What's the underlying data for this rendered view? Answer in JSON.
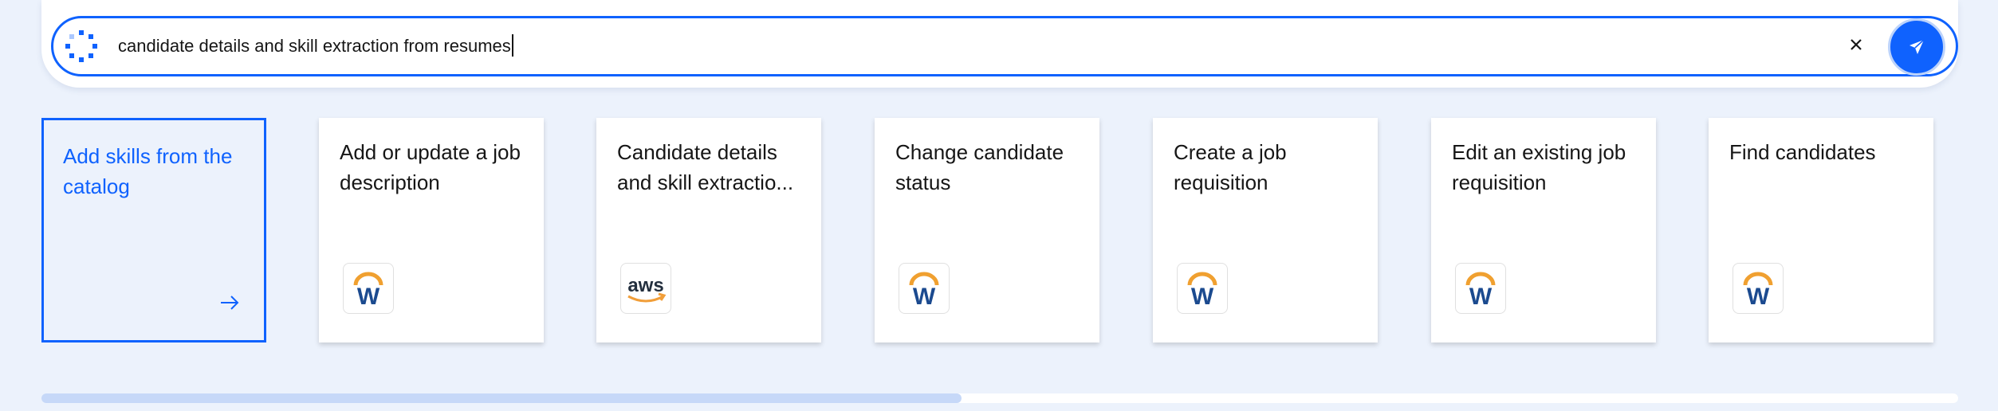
{
  "search": {
    "query": "candidate details and skill extraction from resumes",
    "clear_icon": "close-icon",
    "send_icon": "send-icon",
    "accent_color": "#0f62fe"
  },
  "cards": [
    {
      "title": "Add skills from the catalog",
      "icon": "arrow-right-icon"
    },
    {
      "title": "Add or update a job description",
      "logo": "workday-logo"
    },
    {
      "title": "Candidate details and skill extractio...",
      "logo": "aws-logo"
    },
    {
      "title": "Change candidate status",
      "logo": "workday-logo"
    },
    {
      "title": "Create a job requisition",
      "logo": "workday-logo"
    },
    {
      "title": "Edit an existing job requisition",
      "logo": "workday-logo"
    },
    {
      "title": "Find candidates",
      "logo": "workday-logo"
    }
  ],
  "logo_text": {
    "workday": "W",
    "aws": "aws"
  },
  "scrollbar": {
    "position_fraction": 0.48
  }
}
